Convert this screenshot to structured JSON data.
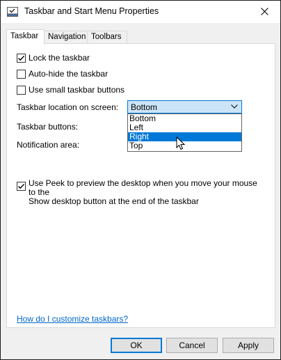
{
  "window": {
    "title": "Taskbar and Start Menu Properties",
    "title_icon": "taskbar-properties-icon",
    "close_icon": "close-icon"
  },
  "tabs": [
    {
      "label": "Taskbar",
      "active": true
    },
    {
      "label": "Navigation",
      "active": false
    },
    {
      "label": "Toolbars",
      "active": false
    }
  ],
  "options": {
    "lock_taskbar": {
      "label": "Lock the taskbar",
      "checked": true
    },
    "auto_hide": {
      "label": "Auto-hide the taskbar",
      "checked": false
    },
    "small_buttons": {
      "label": "Use small taskbar buttons",
      "checked": false
    }
  },
  "location": {
    "label": "Taskbar location on screen:",
    "selected": "Bottom",
    "choices": [
      "Bottom",
      "Left",
      "Right",
      "Top"
    ],
    "highlighted": "Right",
    "arrow_icon": "chevron-down-icon"
  },
  "taskbar_buttons": {
    "label": "Taskbar buttons:"
  },
  "notification_area": {
    "label": "Notification area:"
  },
  "peek": {
    "line1": "Use Peek to preview the desktop when you move your mouse to the",
    "line2": "Show desktop button at the end of the taskbar",
    "checked": true
  },
  "help_link": "How do I customize taskbars?",
  "buttons": {
    "ok": "OK",
    "cancel": "Cancel",
    "apply": "Apply"
  },
  "colors": {
    "accent": "#0078d7",
    "selection_bg": "#cce4f7",
    "link": "#0066cc"
  }
}
